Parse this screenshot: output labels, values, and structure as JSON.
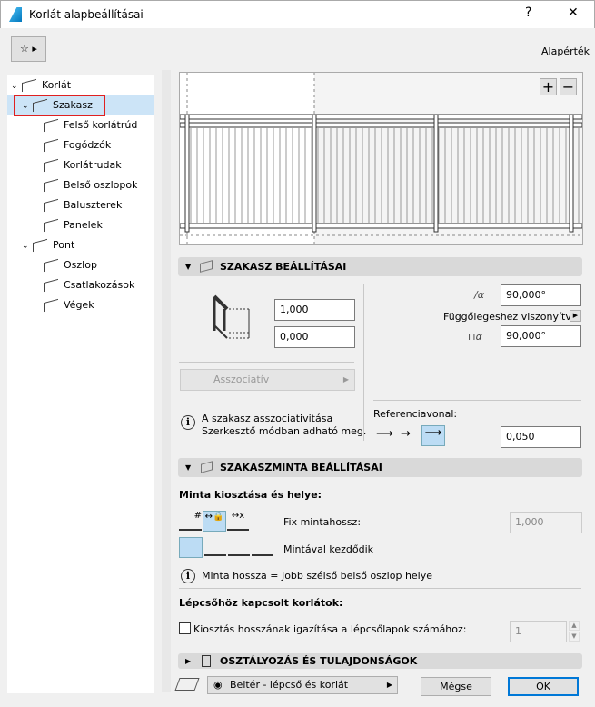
{
  "window": {
    "title": "Korlát alapbeállításai",
    "help": "?",
    "close": "✕"
  },
  "header": {
    "default_label": "Alapérték"
  },
  "tree": [
    {
      "label": "Korlát",
      "level": 0,
      "expanded": true
    },
    {
      "label": "Szakasz",
      "level": 1,
      "expanded": true,
      "selected": true
    },
    {
      "label": "Felső korlátrúd",
      "level": 2
    },
    {
      "label": "Fogódzók",
      "level": 2
    },
    {
      "label": "Korlátrudak",
      "level": 2
    },
    {
      "label": "Belső oszlopok",
      "level": 2
    },
    {
      "label": "Baluszterek",
      "level": 2
    },
    {
      "label": "Panelek",
      "level": 2
    },
    {
      "label": "Pont",
      "level": 1,
      "expanded": true
    },
    {
      "label": "Oszlop",
      "level": 2
    },
    {
      "label": "Csatlakozások",
      "level": 2
    },
    {
      "label": "Végek",
      "level": 2
    }
  ],
  "preview": {
    "zoom_in": "+",
    "zoom_out": "−"
  },
  "segment": {
    "title": "SZAKASZ BEÁLLÍTÁSAI",
    "height": "1,000",
    "offset": "0,000",
    "assoc_label": "Asszociatív",
    "assoc_info": [
      "A szakasz asszociativitása",
      "Szerkesztő módban adható meg."
    ],
    "angle1": "90,000°",
    "relative_label": "Függőlegeshez viszonyítva",
    "angle2": "90,000°",
    "ref_label": "Referenciavonal:",
    "ref_value": "0,050"
  },
  "pattern": {
    "title": "SZAKASZMINTA BEÁLLÍTÁSAI",
    "dist_label": "Minta kiosztása és helye:",
    "fix_label": "Fix mintahossz:",
    "fix_value": "1,000",
    "start_label": "Mintával kezdődik",
    "info": "Minta hossza = Jobb szélső belső oszlop helye",
    "stair_label": "Lépcsőhöz kapcsolt korlátok:",
    "checkbox_label": "Kiosztás hosszának igazítása a lépcsőlapok számához:",
    "checkbox_checked": false,
    "stair_value": "1"
  },
  "classification": {
    "title": "OSZTÁLYOZÁS ÉS TULAJDONSÁGOK"
  },
  "footer": {
    "layer": "Beltér - lépcső és korlát",
    "cancel": "Mégse",
    "ok": "OK"
  }
}
